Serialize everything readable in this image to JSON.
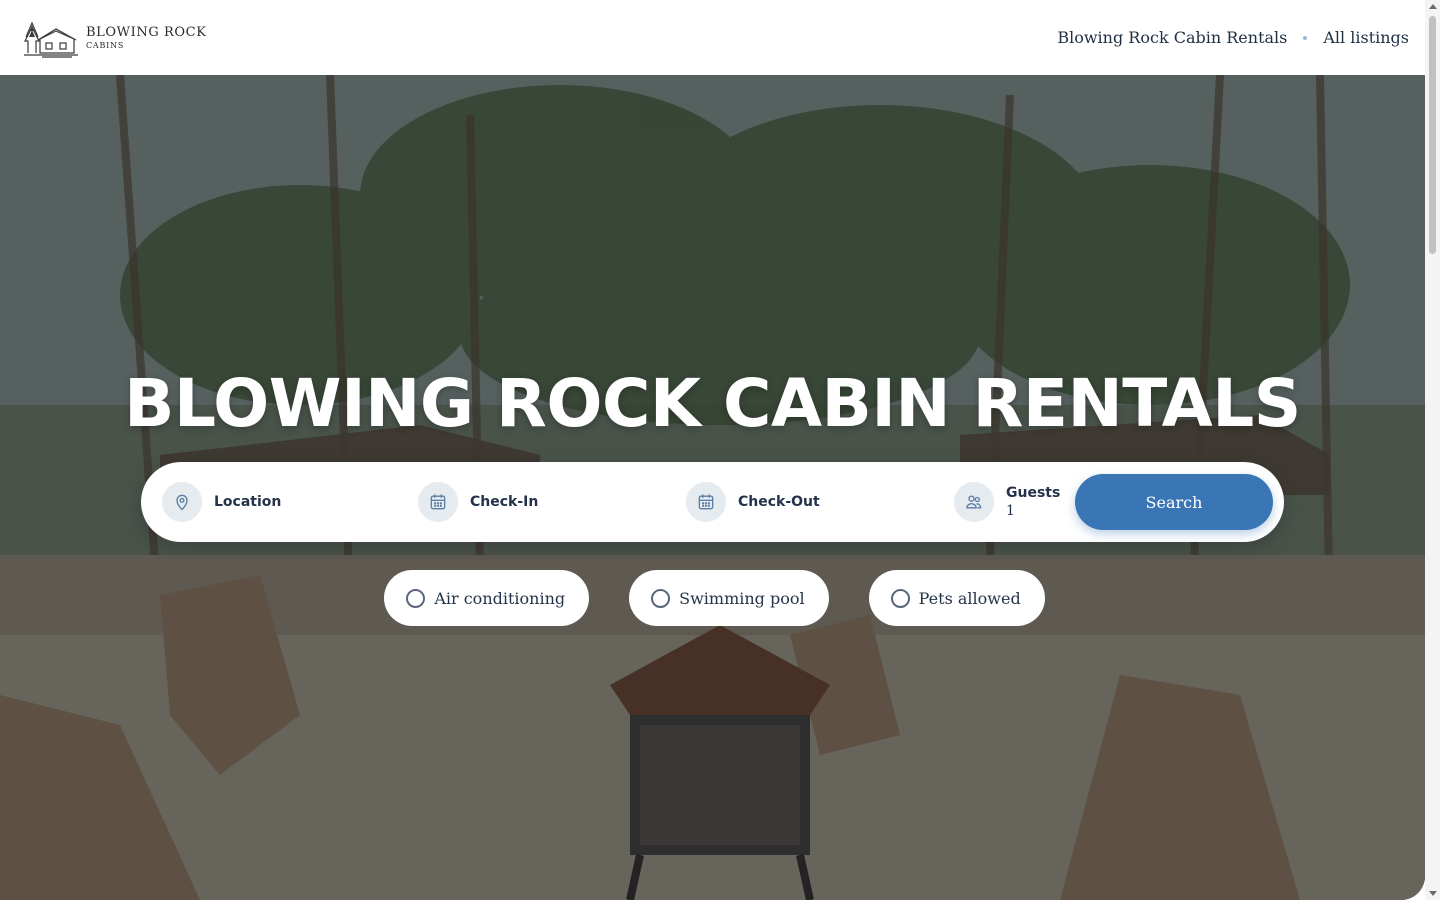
{
  "brand": {
    "title": "BLOWING ROCK",
    "subtitle": "CABINS",
    "icon": "cabin-logo-icon"
  },
  "nav": {
    "items": [
      {
        "label": "Blowing Rock Cabin Rentals"
      },
      {
        "label": "All listings"
      }
    ]
  },
  "hero": {
    "title": "BLOWING ROCK CABIN RENTALS"
  },
  "search": {
    "location": {
      "label": "Location",
      "icon": "map-pin-icon"
    },
    "check_in": {
      "label": "Check-In",
      "icon": "calendar-icon"
    },
    "check_out": {
      "label": "Check-Out",
      "icon": "calendar-icon"
    },
    "guests": {
      "label": "Guests",
      "value": "1",
      "icon": "users-icon"
    },
    "button_label": "Search"
  },
  "amenities": [
    {
      "label": "Air conditioning",
      "checked": false
    },
    {
      "label": "Swimming pool",
      "checked": false
    },
    {
      "label": "Pets allowed",
      "checked": false
    }
  ],
  "colors": {
    "accent": "#3a75b5",
    "text": "#1f2f44",
    "icon_bg": "#e6ebf0"
  }
}
